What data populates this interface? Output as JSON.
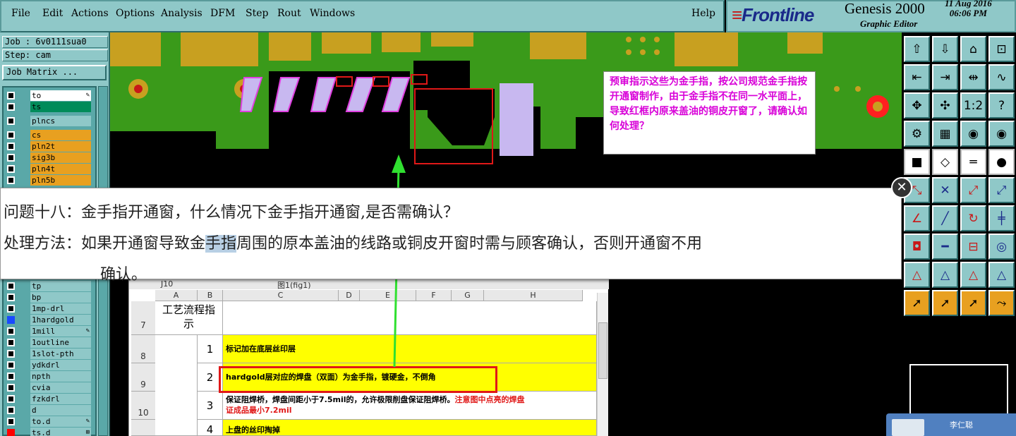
{
  "menu": {
    "items": [
      "File",
      "Edit",
      "Actions",
      "Options",
      "Analysis",
      "DFM",
      "Step",
      "Rout",
      "Windows"
    ],
    "help": "Help"
  },
  "brand": {
    "logo": "Frontline",
    "product": "Genesis 2000",
    "subtitle": "Graphic Editor",
    "date": "11 Aug 2016",
    "time": "06:06 PM"
  },
  "left": {
    "job": "Job : 6v0111sua0",
    "step": "Step: cam",
    "job_matrix": "Job Matrix ...",
    "layers": [
      {
        "name": "to",
        "bg": "#ffffff",
        "box": "black",
        "icon": "✎"
      },
      {
        "name": "ts",
        "bg": "#008b5a",
        "box": "black",
        "icon": ""
      },
      {
        "name": "plncs",
        "bg": "#8fc8c8",
        "box": "black",
        "icon": ""
      },
      {
        "name": "cs",
        "bg": "#e8a020",
        "box": "black",
        "icon": ""
      },
      {
        "name": "pln2t",
        "bg": "#e8a020",
        "box": "black",
        "icon": ""
      },
      {
        "name": "sig3b",
        "bg": "#e8a020",
        "box": "black",
        "icon": ""
      },
      {
        "name": "pln4t",
        "bg": "#e8a020",
        "box": "black",
        "icon": ""
      },
      {
        "name": "pln5b",
        "bg": "#e8a020",
        "box": "black",
        "icon": ""
      },
      {
        "name": "tp",
        "bg": "#8fc8c8",
        "box": "black",
        "icon": ""
      },
      {
        "name": "bp",
        "bg": "#8fc8c8",
        "box": "black",
        "icon": ""
      },
      {
        "name": "1mp-drl",
        "bg": "#8fc8c8",
        "box": "black",
        "icon": ""
      },
      {
        "name": "1hardgold",
        "bg": "#8fc8c8",
        "box": "blue",
        "icon": ""
      },
      {
        "name": "1mill",
        "bg": "#8fc8c8",
        "box": "black",
        "icon": "✎"
      },
      {
        "name": "1outline",
        "bg": "#8fc8c8",
        "box": "black",
        "icon": ""
      },
      {
        "name": "1slot-pth",
        "bg": "#8fc8c8",
        "box": "black",
        "icon": ""
      },
      {
        "name": "ydkdrl",
        "bg": "#8fc8c8",
        "box": "black",
        "icon": ""
      },
      {
        "name": "npth",
        "bg": "#8fc8c8",
        "box": "black",
        "icon": ""
      },
      {
        "name": "cvia",
        "bg": "#8fc8c8",
        "box": "black",
        "icon": ""
      },
      {
        "name": "fzkdrl",
        "bg": "#8fc8c8",
        "box": "black",
        "icon": ""
      },
      {
        "name": "d",
        "bg": "#8fc8c8",
        "box": "black",
        "icon": ""
      },
      {
        "name": "to.d",
        "bg": "#8fc8c8",
        "box": "black",
        "icon": "✎"
      },
      {
        "name": "ts.d",
        "bg": "#8fc8c8",
        "box": "red",
        "icon": "⊞"
      }
    ]
  },
  "graphics": {
    "note": "预审指示这些为金手指，按公司规范金手指按开通窗制作，由于金手指不在同一水平面上，导致红框内原来盖油的铜皮开窗了，请确认如何处理？"
  },
  "popup": {
    "q_label": "问题十八：",
    "q_text": "金手指开通窗，什么情况下金手指开通窗,是否需确认？",
    "a_label": "处理方法：",
    "a_pre": "如果开通窗导致金",
    "a_hl": "手指",
    "a_post": "周围的原本盖油的线路或铜皮开窗时需与顾客确认，否则开通窗不用",
    "a_line2": "确认。"
  },
  "sheet": {
    "cellref": "J10",
    "formula": "图1(fig1)",
    "cols": [
      "A",
      "B",
      "C",
      "D",
      "E",
      "F",
      "G",
      "H"
    ],
    "header_cell": "工艺流程指示",
    "rows": [
      {
        "num": "7",
        "idx": "",
        "text": "",
        "red": ""
      },
      {
        "num": "8",
        "idx": "1",
        "text": "标记加在底层丝印层",
        "red": ""
      },
      {
        "num": "9",
        "idx": "2",
        "text": "hardgold层对应的焊盘（双面）为金手指，镀硬金，不倒角",
        "red": ""
      },
      {
        "num": "10",
        "idx": "3",
        "text": "保证阻焊桥，焊盘间距小于7.5mil的，允许极限削盘保证阻焊桥。",
        "red": "注意图中点亮的焊盘"
      },
      {
        "num": "",
        "idx": "4",
        "text": "上盘的丝印掏掉",
        "red": ""
      }
    ],
    "row10_line2": "证成品最小7.2mil"
  },
  "chat": {
    "name": "李仁聪"
  }
}
